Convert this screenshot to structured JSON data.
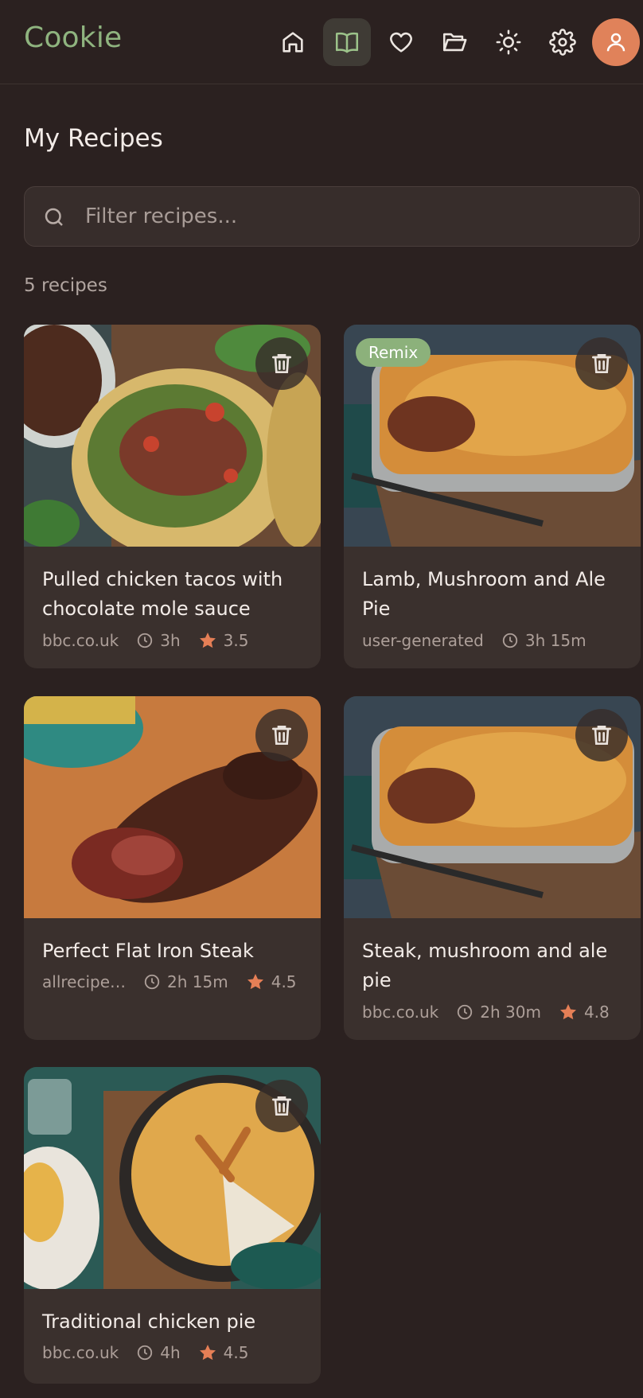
{
  "app": {
    "logo": "Cookie"
  },
  "nav": [
    {
      "name": "home-icon"
    },
    {
      "name": "book-icon"
    },
    {
      "name": "heart-icon"
    },
    {
      "name": "folder-icon"
    },
    {
      "name": "sun-icon"
    },
    {
      "name": "gear-icon"
    }
  ],
  "colors": {
    "accent": "#8fb47f",
    "avatar": "#e0825a",
    "star": "#e57f56",
    "background": "#2b2120",
    "card": "#3a302d"
  },
  "page": {
    "title": "My Recipes",
    "count": "5 recipes"
  },
  "search": {
    "placeholder": "Filter recipes..."
  },
  "recipes": [
    {
      "title": "Pulled chicken tacos with chocolate mole sauce",
      "source": "bbc.co.uk",
      "time": "3h",
      "rating": "3.5",
      "badge": ""
    },
    {
      "title": "Lamb, Mushroom and Ale Pie",
      "source": "user-generated",
      "time": "3h 15m",
      "rating": "",
      "badge": "Remix"
    },
    {
      "title": "Perfect Flat Iron Steak",
      "source": "allrecipe…",
      "time": "2h 15m",
      "rating": "4.5",
      "badge": ""
    },
    {
      "title": "Steak, mushroom and ale pie",
      "source": "bbc.co.uk",
      "time": "2h 30m",
      "rating": "4.8",
      "badge": ""
    },
    {
      "title": "Traditional chicken pie",
      "source": "bbc.co.uk",
      "time": "4h",
      "rating": "4.5",
      "badge": ""
    }
  ]
}
